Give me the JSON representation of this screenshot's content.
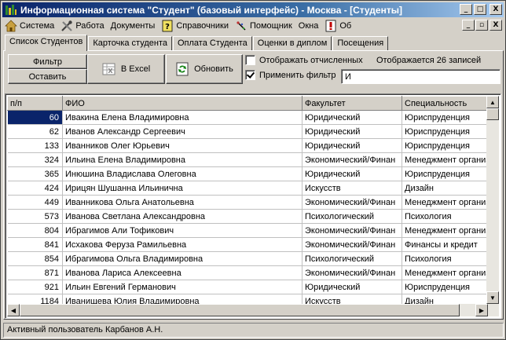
{
  "window": {
    "title": "Информационная система \"Студент\" (базовый интерфейс) - Москва - [Студенты]",
    "controls": {
      "minimize": "_",
      "maximize": "□",
      "close": "X"
    }
  },
  "menubar": {
    "items": [
      {
        "label": "Система",
        "icon": "house-icon"
      },
      {
        "label": "Работа",
        "icon": "tools-icon"
      },
      {
        "label": "Документы",
        "icon": ""
      },
      {
        "label": "Справочники",
        "icon": "help-book-icon"
      },
      {
        "label": "Помощник",
        "icon": "assistant-icon"
      },
      {
        "label": "Окна",
        "icon": ""
      },
      {
        "label": "Об",
        "icon": "about-icon"
      }
    ],
    "mdi_controls": {
      "minimize": "_",
      "restore": "▫",
      "close": "X"
    }
  },
  "tabs": [
    {
      "label": "Список Студентов",
      "active": true
    },
    {
      "label": "Карточка студента",
      "active": false
    },
    {
      "label": "Оплата Студента",
      "active": false
    },
    {
      "label": "Оценки в диплом",
      "active": false
    },
    {
      "label": "Посещения",
      "active": false
    }
  ],
  "toolbar": {
    "filter_label": "Фильтр",
    "reset_label": "Оставить",
    "excel_label": "В Excel",
    "refresh_label": "Обновить",
    "show_expelled_label": "Отображать отчисленных",
    "show_expelled_checked": false,
    "apply_filter_label": "Применить фильтр",
    "apply_filter_checked": true,
    "records_text": "Отображается 26 записей",
    "filter_value": "И"
  },
  "table": {
    "columns": [
      "п/п",
      "ФИО",
      "Факультет",
      "Специальность"
    ],
    "rows": [
      {
        "num": "60",
        "name": "Ивакина Елена Владимировна",
        "faculty": "Юридический",
        "specialty": "Юриспруденция",
        "selected": true
      },
      {
        "num": "62",
        "name": "Иванов Александр Сергеевич",
        "faculty": "Юридический",
        "specialty": "Юриспруденция"
      },
      {
        "num": "133",
        "name": "Иванников Олег Юрьевич",
        "faculty": "Юридический",
        "specialty": "Юриспруденция"
      },
      {
        "num": "324",
        "name": "Ильина Елена Владимировна",
        "faculty": "Экономический/Финан",
        "specialty": "Менеджмент организ"
      },
      {
        "num": "365",
        "name": "Инюшина Владислава Олеговна",
        "faculty": "Юридический",
        "specialty": "Юриспруденция"
      },
      {
        "num": "424",
        "name": "Ирицян Шушанна Ильинична",
        "faculty": "Искусств",
        "specialty": "Дизайн"
      },
      {
        "num": "449",
        "name": "Иванникова Ольга Анатольевна",
        "faculty": "Экономический/Финан",
        "specialty": "Менеджмент организ"
      },
      {
        "num": "573",
        "name": "Иванова Светлана Александровна",
        "faculty": "Психологический",
        "specialty": "Психология"
      },
      {
        "num": "804",
        "name": "Ибрагимов Али Тофикович",
        "faculty": "Экономический/Финан",
        "specialty": "Менеджмент организ"
      },
      {
        "num": "841",
        "name": "Исхакова Феруза Рамильевна",
        "faculty": "Экономический/Финан",
        "specialty": "Финансы и кредит"
      },
      {
        "num": "854",
        "name": "Ибрагимова Ольга Владимировна",
        "faculty": "Психологический",
        "specialty": "Психология"
      },
      {
        "num": "871",
        "name": "Иванова Лариса Алексеевна",
        "faculty": "Экономический/Финан",
        "specialty": "Менеджмент организ"
      },
      {
        "num": "921",
        "name": "Ильин Евгений Германович",
        "faculty": "Юридический",
        "specialty": "Юриспруденция"
      },
      {
        "num": "1184",
        "name": "Иванищева Юлия Владимировна",
        "faculty": "Искусств",
        "specialty": "Дизайн"
      }
    ]
  },
  "statusbar": {
    "text": "Активный пользователь Карбанов А.Н."
  },
  "colors": {
    "title_start": "#0a246a",
    "title_end": "#a6caf0",
    "selection": "#0a246a",
    "face": "#d4d0c8"
  }
}
